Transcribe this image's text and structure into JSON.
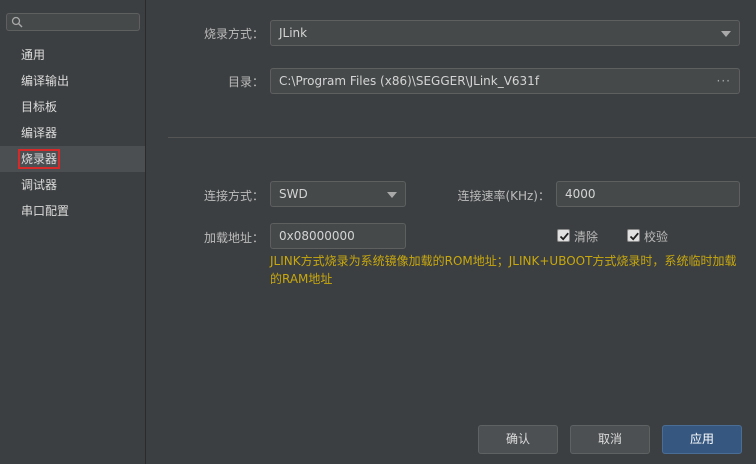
{
  "sidebar": {
    "search_placeholder": "",
    "items": [
      {
        "label": "通用"
      },
      {
        "label": "编译输出"
      },
      {
        "label": "目标板"
      },
      {
        "label": "编译器"
      },
      {
        "label": "烧录器",
        "selected": true
      },
      {
        "label": "调试器"
      },
      {
        "label": "串口配置"
      }
    ]
  },
  "form": {
    "burn_mode_label": "烧录方式：",
    "burn_mode_value": "JLink",
    "dir_label": "目录：",
    "dir_value": "C:\\Program Files (x86)\\SEGGER\\JLink_V631f",
    "dir_browse": "···",
    "connect_mode_label": "连接方式：",
    "connect_mode_value": "SWD",
    "connect_speed_label": "连接速率(KHz)：",
    "connect_speed_value": "4000",
    "load_addr_label": "加载地址：",
    "load_addr_value": "0x08000000",
    "erase_label": "清除",
    "erase_checked": true,
    "verify_label": "校验",
    "verify_checked": true,
    "hint": "JLINK方式烧录为系统镜像加载的ROM地址；JLINK+UBOOT方式烧录时，系统临时加载的RAM地址"
  },
  "buttons": {
    "ok": "确认",
    "cancel": "取消",
    "apply": "应用"
  },
  "colors": {
    "background": "#3c3f41",
    "hint": "#c8a80e",
    "selection_outline": "#d62a2a",
    "primary_button": "#365880"
  }
}
